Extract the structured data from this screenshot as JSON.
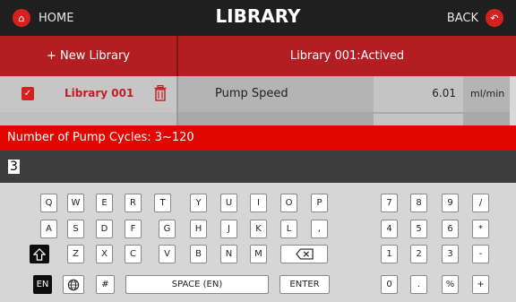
{
  "topbar": {
    "home_label": "HOME",
    "title": "LIBRARY",
    "back_label": "BACK",
    "accent": "#d62020"
  },
  "header": {
    "new_library": "+ New Library",
    "active_library": "Library 001:Actived"
  },
  "libraries": [
    {
      "name": "Library 001"
    }
  ],
  "params": [
    {
      "label": "Pump Speed",
      "value": "6.01",
      "unit": "ml/min"
    }
  ],
  "prompt": {
    "text": "Number of Pump Cycles: 3~120",
    "color": "#e10600"
  },
  "input": {
    "value": "3"
  },
  "keyboard": {
    "rows": [
      [
        "Q",
        "W",
        "E",
        "R",
        "T",
        "Y",
        "U",
        "I",
        "O",
        "P"
      ],
      [
        "A",
        "S",
        "D",
        "F",
        "G",
        "H",
        "J",
        "K",
        "L",
        ","
      ],
      [
        "shift-icon",
        "Z",
        "X",
        "C",
        "V",
        "B",
        "N",
        "M",
        "backspace-icon"
      ],
      [
        "EN",
        "globe-icon",
        "#",
        "SPACE (EN)",
        "ENTER"
      ]
    ],
    "numpad": [
      [
        "7",
        "8",
        "9",
        "/"
      ],
      [
        "4",
        "5",
        "6",
        "*"
      ],
      [
        "1",
        "2",
        "3",
        "-"
      ],
      [
        "0",
        ".",
        "%",
        "+"
      ]
    ]
  }
}
